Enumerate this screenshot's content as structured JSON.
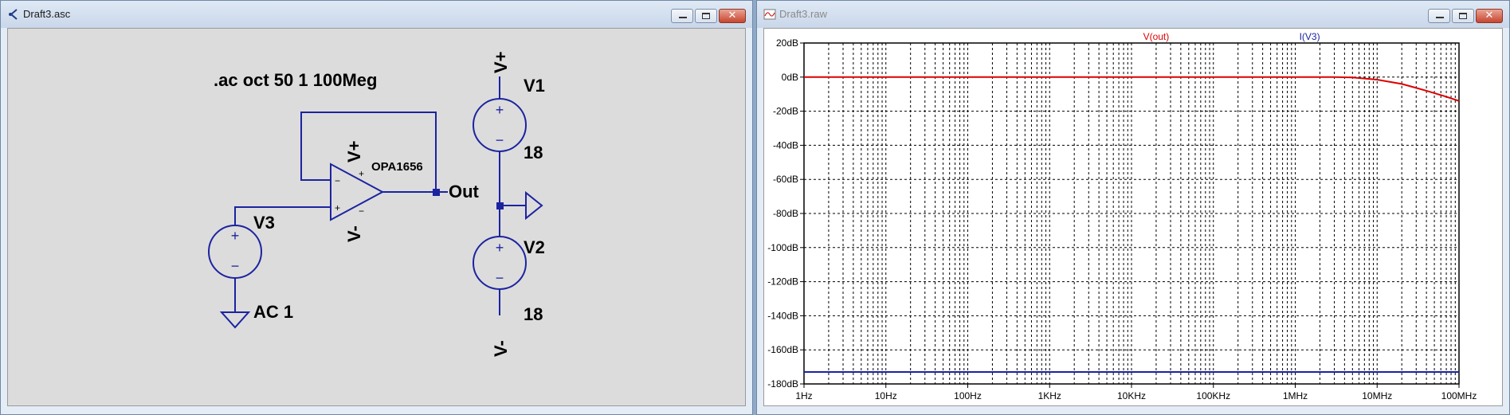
{
  "schematic_window": {
    "title": "Draft3.asc",
    "directive": ".ac oct 50 1 100Meg",
    "opamp": {
      "name": "OPA1656",
      "pos_supply": "V+",
      "neg_supply": "V-",
      "plus": "+",
      "minus": "−"
    },
    "v1": {
      "name": "V1",
      "value": "18",
      "top_net": "V+"
    },
    "v2": {
      "name": "V2",
      "value": "18",
      "bottom_net": "V-"
    },
    "v3": {
      "name": "V3",
      "value": "AC 1"
    },
    "out_label": "Out",
    "source_plus": "+",
    "source_minus": "−"
  },
  "plot_window": {
    "title": "Draft3.raw"
  },
  "window_controls": {
    "minimize": "minimize",
    "maximize": "maximize",
    "close": "✕"
  },
  "colors": {
    "vout": "#dd0000",
    "iv3": "#1c23a0"
  },
  "chart_data": {
    "type": "line",
    "x_scale": "log",
    "xlim": [
      1,
      100000000
    ],
    "ylim": [
      -180,
      20
    ],
    "grid": true,
    "x_ticks": [
      "1Hz",
      "10Hz",
      "100Hz",
      "1KHz",
      "10KHz",
      "100KHz",
      "1MHz",
      "10MHz",
      "100MHz"
    ],
    "y_ticks": [
      "20dB",
      "0dB",
      "-20dB",
      "-40dB",
      "-60dB",
      "-80dB",
      "-100dB",
      "-120dB",
      "-140dB",
      "-160dB",
      "-180dB"
    ],
    "series": [
      {
        "name": "V(out)",
        "color": "#dd0000",
        "x": [
          1,
          1000000,
          3000000,
          5000000,
          10000000,
          20000000,
          40000000,
          70000000,
          100000000
        ],
        "y": [
          0,
          0,
          0,
          -0.2,
          -1.5,
          -4,
          -8,
          -11.5,
          -14
        ]
      },
      {
        "name": "I(V3)",
        "color": "#1c23a0",
        "x": [
          1,
          100000000
        ],
        "y": [
          -173,
          -173
        ]
      }
    ]
  }
}
